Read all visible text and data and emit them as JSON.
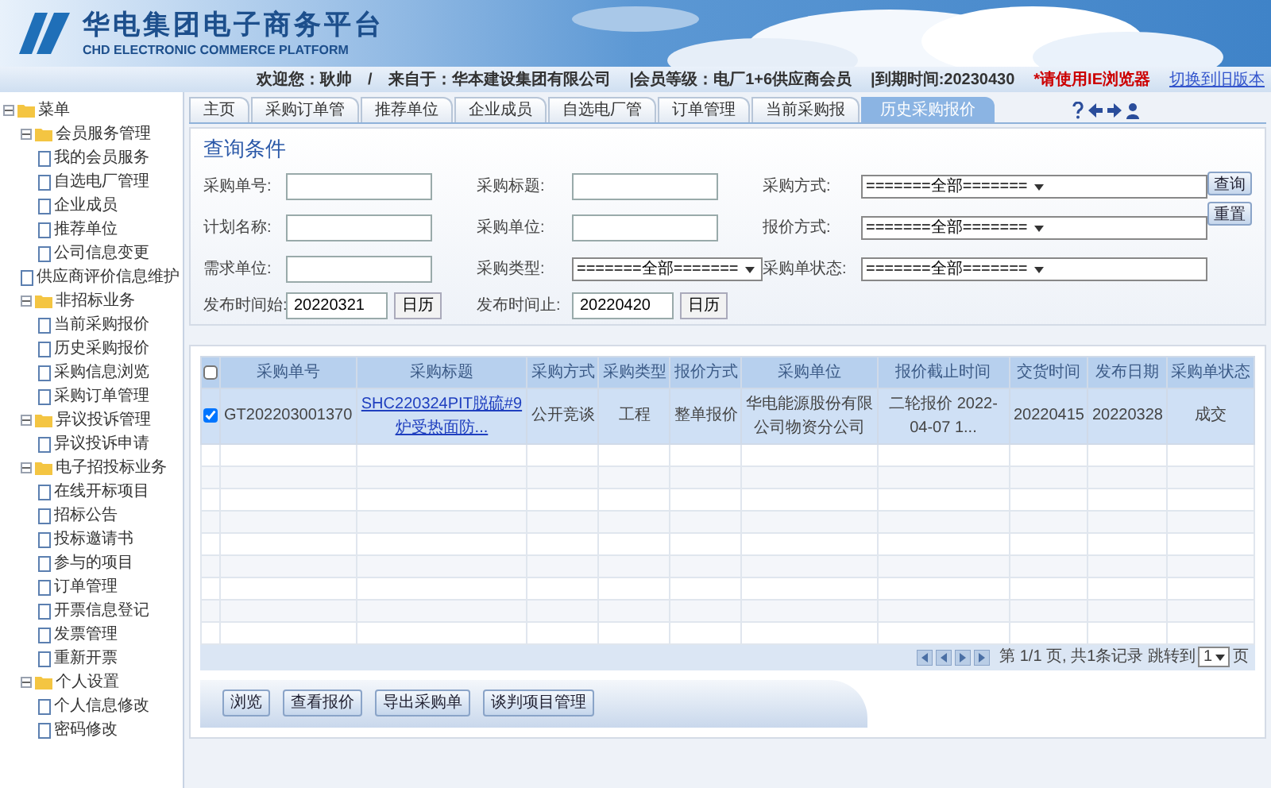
{
  "header": {
    "title": "华电集团电子商务平台",
    "subtitle": "CHD ELECTRONIC COMMERCE PLATFORM"
  },
  "info_bar": {
    "welcome": "欢迎您：耿帅　/　来自于：华本建设集团有限公司",
    "level": "|会员等级：电厂1+6供应商会员",
    "expiry": "|到期时间:20230430",
    "browser_note": "*请使用IE浏览器",
    "switch_link": "切换到旧版本"
  },
  "sidebar": {
    "items": [
      {
        "label": "菜单",
        "expanded": true,
        "children": [
          {
            "label": "会员服务管理",
            "expanded": true,
            "children": [
              {
                "label": "我的会员服务"
              },
              {
                "label": "自选电厂管理"
              },
              {
                "label": "企业成员"
              },
              {
                "label": "推荐单位"
              },
              {
                "label": "公司信息变更"
              }
            ]
          },
          {
            "label": "供应商评价信息维护"
          },
          {
            "label": "非招标业务",
            "expanded": true,
            "children": [
              {
                "label": "当前采购报价"
              },
              {
                "label": "历史采购报价"
              },
              {
                "label": "采购信息浏览"
              },
              {
                "label": "采购订单管理"
              }
            ]
          },
          {
            "label": "异议投诉管理",
            "expanded": true,
            "children": [
              {
                "label": "异议投诉申请"
              }
            ]
          },
          {
            "label": "电子招投标业务",
            "expanded": true,
            "children": [
              {
                "label": "在线开标项目"
              },
              {
                "label": "招标公告"
              },
              {
                "label": "投标邀请书"
              },
              {
                "label": "参与的项目"
              },
              {
                "label": "订单管理"
              },
              {
                "label": "开票信息登记"
              },
              {
                "label": "发票管理"
              },
              {
                "label": "重新开票"
              }
            ]
          },
          {
            "label": "个人设置",
            "expanded": true,
            "children": [
              {
                "label": "个人信息修改"
              },
              {
                "label": "密码修改"
              }
            ]
          }
        ]
      }
    ]
  },
  "tabs": [
    {
      "label": "主页",
      "selected": false
    },
    {
      "label": "采购订单管",
      "selected": false
    },
    {
      "label": "推荐单位",
      "selected": false
    },
    {
      "label": "企业成员",
      "selected": false
    },
    {
      "label": "自选电厂管",
      "selected": false
    },
    {
      "label": "订单管理",
      "selected": false
    },
    {
      "label": "当前采购报",
      "selected": false
    },
    {
      "label": "历史采购报价",
      "selected": true
    }
  ],
  "query": {
    "title": "查询条件",
    "fields": [
      {
        "label": "采购单号:",
        "kind": "text"
      },
      {
        "label": "采购标题:",
        "kind": "text"
      },
      {
        "label": "采购方式:",
        "kind": "select",
        "value": "=======全部======="
      },
      {
        "label": "计划名称:",
        "kind": "text"
      },
      {
        "label": "采购单位:",
        "kind": "text"
      },
      {
        "label": "报价方式:",
        "kind": "select",
        "value": "=======全部======="
      },
      {
        "label": "需求单位:",
        "kind": "text"
      },
      {
        "label": "采购类型:",
        "kind": "select",
        "value": "=======全部======="
      },
      {
        "label": "采购单状态:",
        "kind": "select",
        "value": "=======全部======="
      },
      {
        "label": "发布时间始:",
        "kind": "date",
        "value": "20220321",
        "button": "日历"
      },
      {
        "label": "发布时间止:",
        "kind": "date",
        "value": "20220420",
        "button": "日历"
      }
    ],
    "buttons": [
      "查询",
      "重置"
    ]
  },
  "table": {
    "columns": [
      "采购单号",
      "采购标题",
      "采购方式",
      "采购类型",
      "报价方式",
      "采购单位",
      "报价截止时间",
      "交货时间",
      "发布日期",
      "采购单状态"
    ],
    "header_checked": false,
    "rows": [
      {
        "checked": true,
        "selected": true,
        "cells": [
          "GT202203001370",
          "SHC220324PIT脱硫#9炉受热面防...",
          "公开竞谈",
          "工程",
          "整单报价",
          "华电能源股份有限公司物资分公司",
          "二轮报价 2022-04-07 1...",
          "20220415",
          "20220328",
          "成交"
        ]
      }
    ]
  },
  "pager": {
    "text": "第 1/1 页, 共1条记录 跳转到",
    "page": "1",
    "suffix": "页"
  },
  "actions": [
    "浏览",
    "查看报价",
    "导出采购单",
    "谈判项目管理"
  ]
}
